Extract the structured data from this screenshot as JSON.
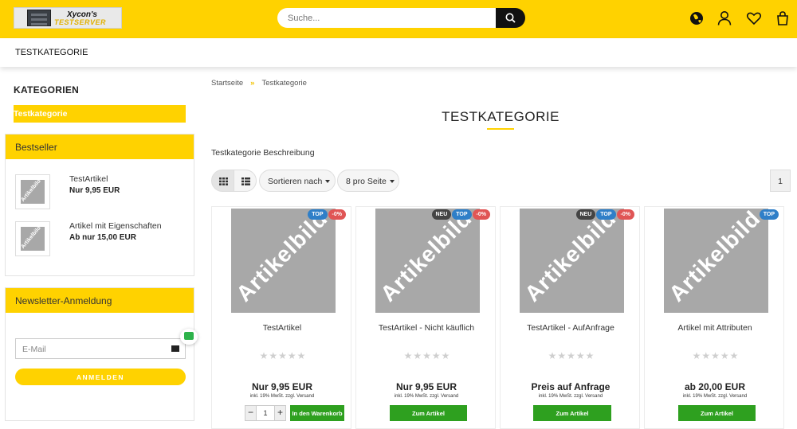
{
  "header": {
    "logo": {
      "line1": "Xycon's",
      "line2": "TESTSERVER"
    },
    "search_placeholder": "Suche...",
    "icons": [
      "globe-icon",
      "user-icon",
      "heart-icon",
      "bag-icon"
    ]
  },
  "nav": {
    "items": [
      "TESTKATEGORIE"
    ]
  },
  "sidebar": {
    "categories_title": "KATEGORIEN",
    "active_category": "Testkategorie",
    "bestseller": {
      "title": "Bestseller",
      "thumb_label": "Artikelbild",
      "items": [
        {
          "name": "TestArtikel",
          "price": "Nur 9,95 EUR"
        },
        {
          "name": "Artikel mit Eigenschaften",
          "price": "Ab nur 15,00 EUR"
        }
      ]
    },
    "newsletter": {
      "title": "Newsletter-Anmeldung",
      "email_placeholder": "E-Mail",
      "submit": "ANMELDEN"
    }
  },
  "main": {
    "breadcrumb": [
      "Startseite",
      "Testkategorie"
    ],
    "title": "TESTKATEGORIE",
    "description": "Testkategorie Beschreibung",
    "sort_label": "Sortieren nach",
    "per_page_label": "8 pro Seite",
    "page": "1",
    "image_label": "Artikelbild",
    "tax_note": "inkl. 19% MwSt. zzgl. Versand",
    "products": [
      {
        "name": "TestArtikel",
        "badges": [
          "TOP",
          "-0%"
        ],
        "price": "Nur 9,95 EUR",
        "button": "In den Warenkorb",
        "qty": "1",
        "rating": 0
      },
      {
        "name": "TestArtikel - Nicht käuflich",
        "badges": [
          "NEU",
          "TOP",
          "-0%"
        ],
        "price": "Nur 9,95 EUR",
        "button": "Zum Artikel",
        "rating": 0
      },
      {
        "name": "TestArtikel - AufAnfrage",
        "badges": [
          "NEU",
          "TOP",
          "-0%"
        ],
        "price": "Preis auf Anfrage",
        "button": "Zum Artikel",
        "rating": 0
      },
      {
        "name": "Artikel mit Attributen",
        "badges": [
          "TOP"
        ],
        "price": "ab 20,00 EUR",
        "button": "Zum Artikel",
        "rating": 0
      }
    ]
  },
  "colors": {
    "brand_yellow": "#ffd200",
    "cart_green": "#2ea01f",
    "badge_top": "#2f7fc8",
    "badge_sale": "#e05555",
    "badge_new": "#444444"
  }
}
